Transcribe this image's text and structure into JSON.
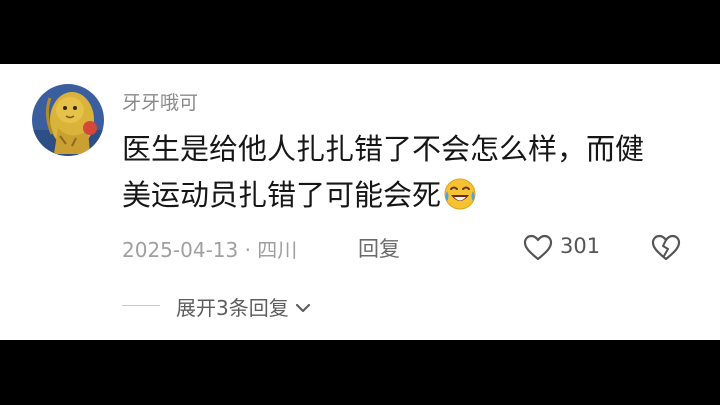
{
  "comment": {
    "username": "牙牙哦可",
    "text_line1": "医生是给他人扎扎错了不会怎么样，而健",
    "text_line2": "美运动员扎错了可能会死",
    "emoji": "laughing-crying-emoji",
    "date_location": "2025-04-13 · 四川",
    "reply_label": "回复",
    "like_count": "301",
    "expand_replies_label": "展开3条回复"
  },
  "icons": {
    "like": "heart-outline-icon",
    "dislike": "broken-heart-icon",
    "expand": "chevron-down-icon"
  },
  "colors": {
    "background": "#ffffff",
    "frame": "#000000",
    "username": "#8a8a8a",
    "comment_text": "#161616",
    "meta": "#a0a0a0"
  }
}
